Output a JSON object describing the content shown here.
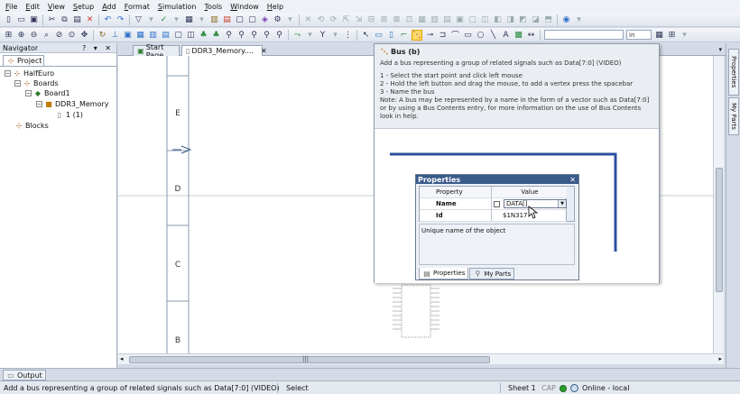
{
  "menu": [
    "File",
    "Edit",
    "View",
    "Setup",
    "Add",
    "Format",
    "Simulation",
    "Tools",
    "Window",
    "Help"
  ],
  "toolbar": {
    "zoom_combo_value": "",
    "unit_combo_value": "in"
  },
  "navigator": {
    "title": "Navigator",
    "header_buttons": "? ▾ ✕",
    "tab_label": "Project",
    "tree": {
      "root": "HalfEuro",
      "boards": "Boards",
      "board1": "Board1",
      "design": "DDR3_Memory",
      "sheet": "1 (1)",
      "blocks": "Blocks"
    }
  },
  "tabs": [
    {
      "label": "Start Page",
      "active": false
    },
    {
      "label": "DDR3_Memory....",
      "active": true
    }
  ],
  "canvas": {
    "zone_labels": [
      "E",
      "D",
      "C",
      "B"
    ]
  },
  "tooltip": {
    "title": "Bus (b)",
    "summary": "Add a bus representing a group of related signals such as Data[7:0] (VIDEO)",
    "steps": [
      "1 - Select the start point and click left mouse",
      "2 - Hold the left button and drag the mouse, to add a vertex press the spacebar",
      "3 - Name the bus"
    ],
    "note": "Note: A bus may be represented by a name in the form of a vector such as Data[7:0] or by using a Bus Contents entry, for more information on the use of Bus Contents look in help."
  },
  "properties": {
    "title": "Properties",
    "col_property": "Property",
    "col_value": "Value",
    "rows": [
      {
        "name": "Name",
        "value": "DATA[]"
      },
      {
        "name": "Id",
        "value": "$1N317"
      }
    ],
    "description": "Unique name of the object",
    "tabs": [
      "Properties",
      "My Parts"
    ]
  },
  "right_tabs": [
    "Properties",
    "My Parts"
  ],
  "output_tab": "Output",
  "status": {
    "message": "Add a bus representing a group of related signals such as Data[7:0] (VIDEO)",
    "mode": "Select",
    "sheet": "Sheet 1",
    "caps": "CAP",
    "online": "Online - local"
  },
  "colors": {
    "accent": "#3a5a8a",
    "selection_highlight": "#ffd86a",
    "status_online": "#2aa02a",
    "frame_line": "#2b4f9e"
  }
}
